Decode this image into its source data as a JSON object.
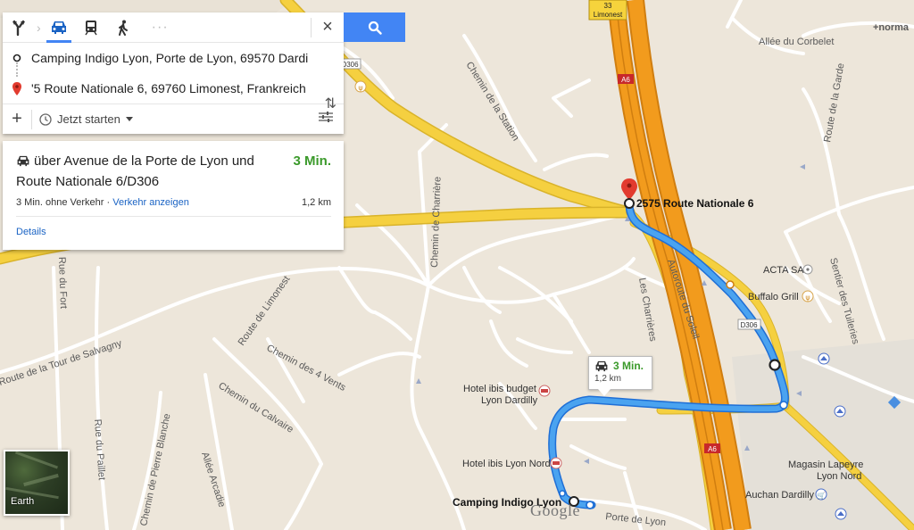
{
  "directions": {
    "modes": [
      {
        "name": "best-route",
        "active": false
      },
      {
        "name": "driving",
        "active": true
      },
      {
        "name": "transit",
        "active": false
      },
      {
        "name": "walking",
        "active": false
      }
    ],
    "more_modes": "···",
    "close_label": "×",
    "origin": "Camping Indigo Lyon, Porte de Lyon, 69570 Dardi",
    "destination": "'5 Route Nationale 6, 69760 Limonest, Frankreich",
    "swap_label": "⇅",
    "add_label": "+",
    "depart_label": "Jetzt starten"
  },
  "route": {
    "title": "über Avenue de la Porte de Lyon und Route Nationale 6/D306",
    "duration": "3 Min.",
    "traffic_note": "3 Min. ohne Verkehr · ",
    "traffic_link": "Verkehr anzeigen",
    "distance": "1,2 km",
    "details": "Details"
  },
  "popup": {
    "duration": "3 Min.",
    "distance": "1,2 km"
  },
  "earth": {
    "label": "Earth"
  },
  "logo": "Google",
  "map": {
    "destination_label": "2575 Route Nationale 6",
    "origin_label": "Camping Indigo Lyon",
    "roads": {
      "allee_corbelet": "Allée du Corbelet",
      "normandie": "+norma",
      "chemin_station": "Chemin de la Station",
      "route_garde": "Route de la Garde",
      "sentier_tuileries": "Sentier des Tuileries",
      "chemin_charriere": "Chemin de Charrière",
      "route_limonest": "Route de Limonest",
      "les_charrieres": "Les Charrières",
      "autoroute": "Autoroute du Soleil",
      "chemin_4_vents": "Chemin des 4 Vents",
      "chemin_calvaire": "Chemin du Calvaire",
      "tour_salvagny": "Route de la Tour de Salvagny",
      "rue_fort": "Rue du Fort",
      "rue_paillet": "Rue du Paillet",
      "chemin_pierre_blanche": "Chemin de Pierre Blanche",
      "allee_arcadie": "Allée Arcadie",
      "porte_lyon": "Porte de Lyon"
    },
    "shields": {
      "limonest_num": "33",
      "limonest": "Limonest",
      "a6": "A6",
      "d306": "D306"
    },
    "pois": {
      "acta": "ACTA SA",
      "buffalo": "Buffalo Grill",
      "ibis_budget_1": "Hotel ibis budget",
      "ibis_budget_2": "Lyon Dardilly",
      "ibis_nord": "Hotel ibis Lyon Nord",
      "lapeyre_1": "Magasin Lapeyre",
      "lapeyre_2": "Lyon Nord",
      "auchan": "Auchan Dardilly"
    }
  },
  "colors": {
    "route": "#4aa3f0",
    "highway": "#f29b1d",
    "main_road": "#f5d040",
    "accent": "#4285f4",
    "duration_green": "#3b9a2b"
  }
}
